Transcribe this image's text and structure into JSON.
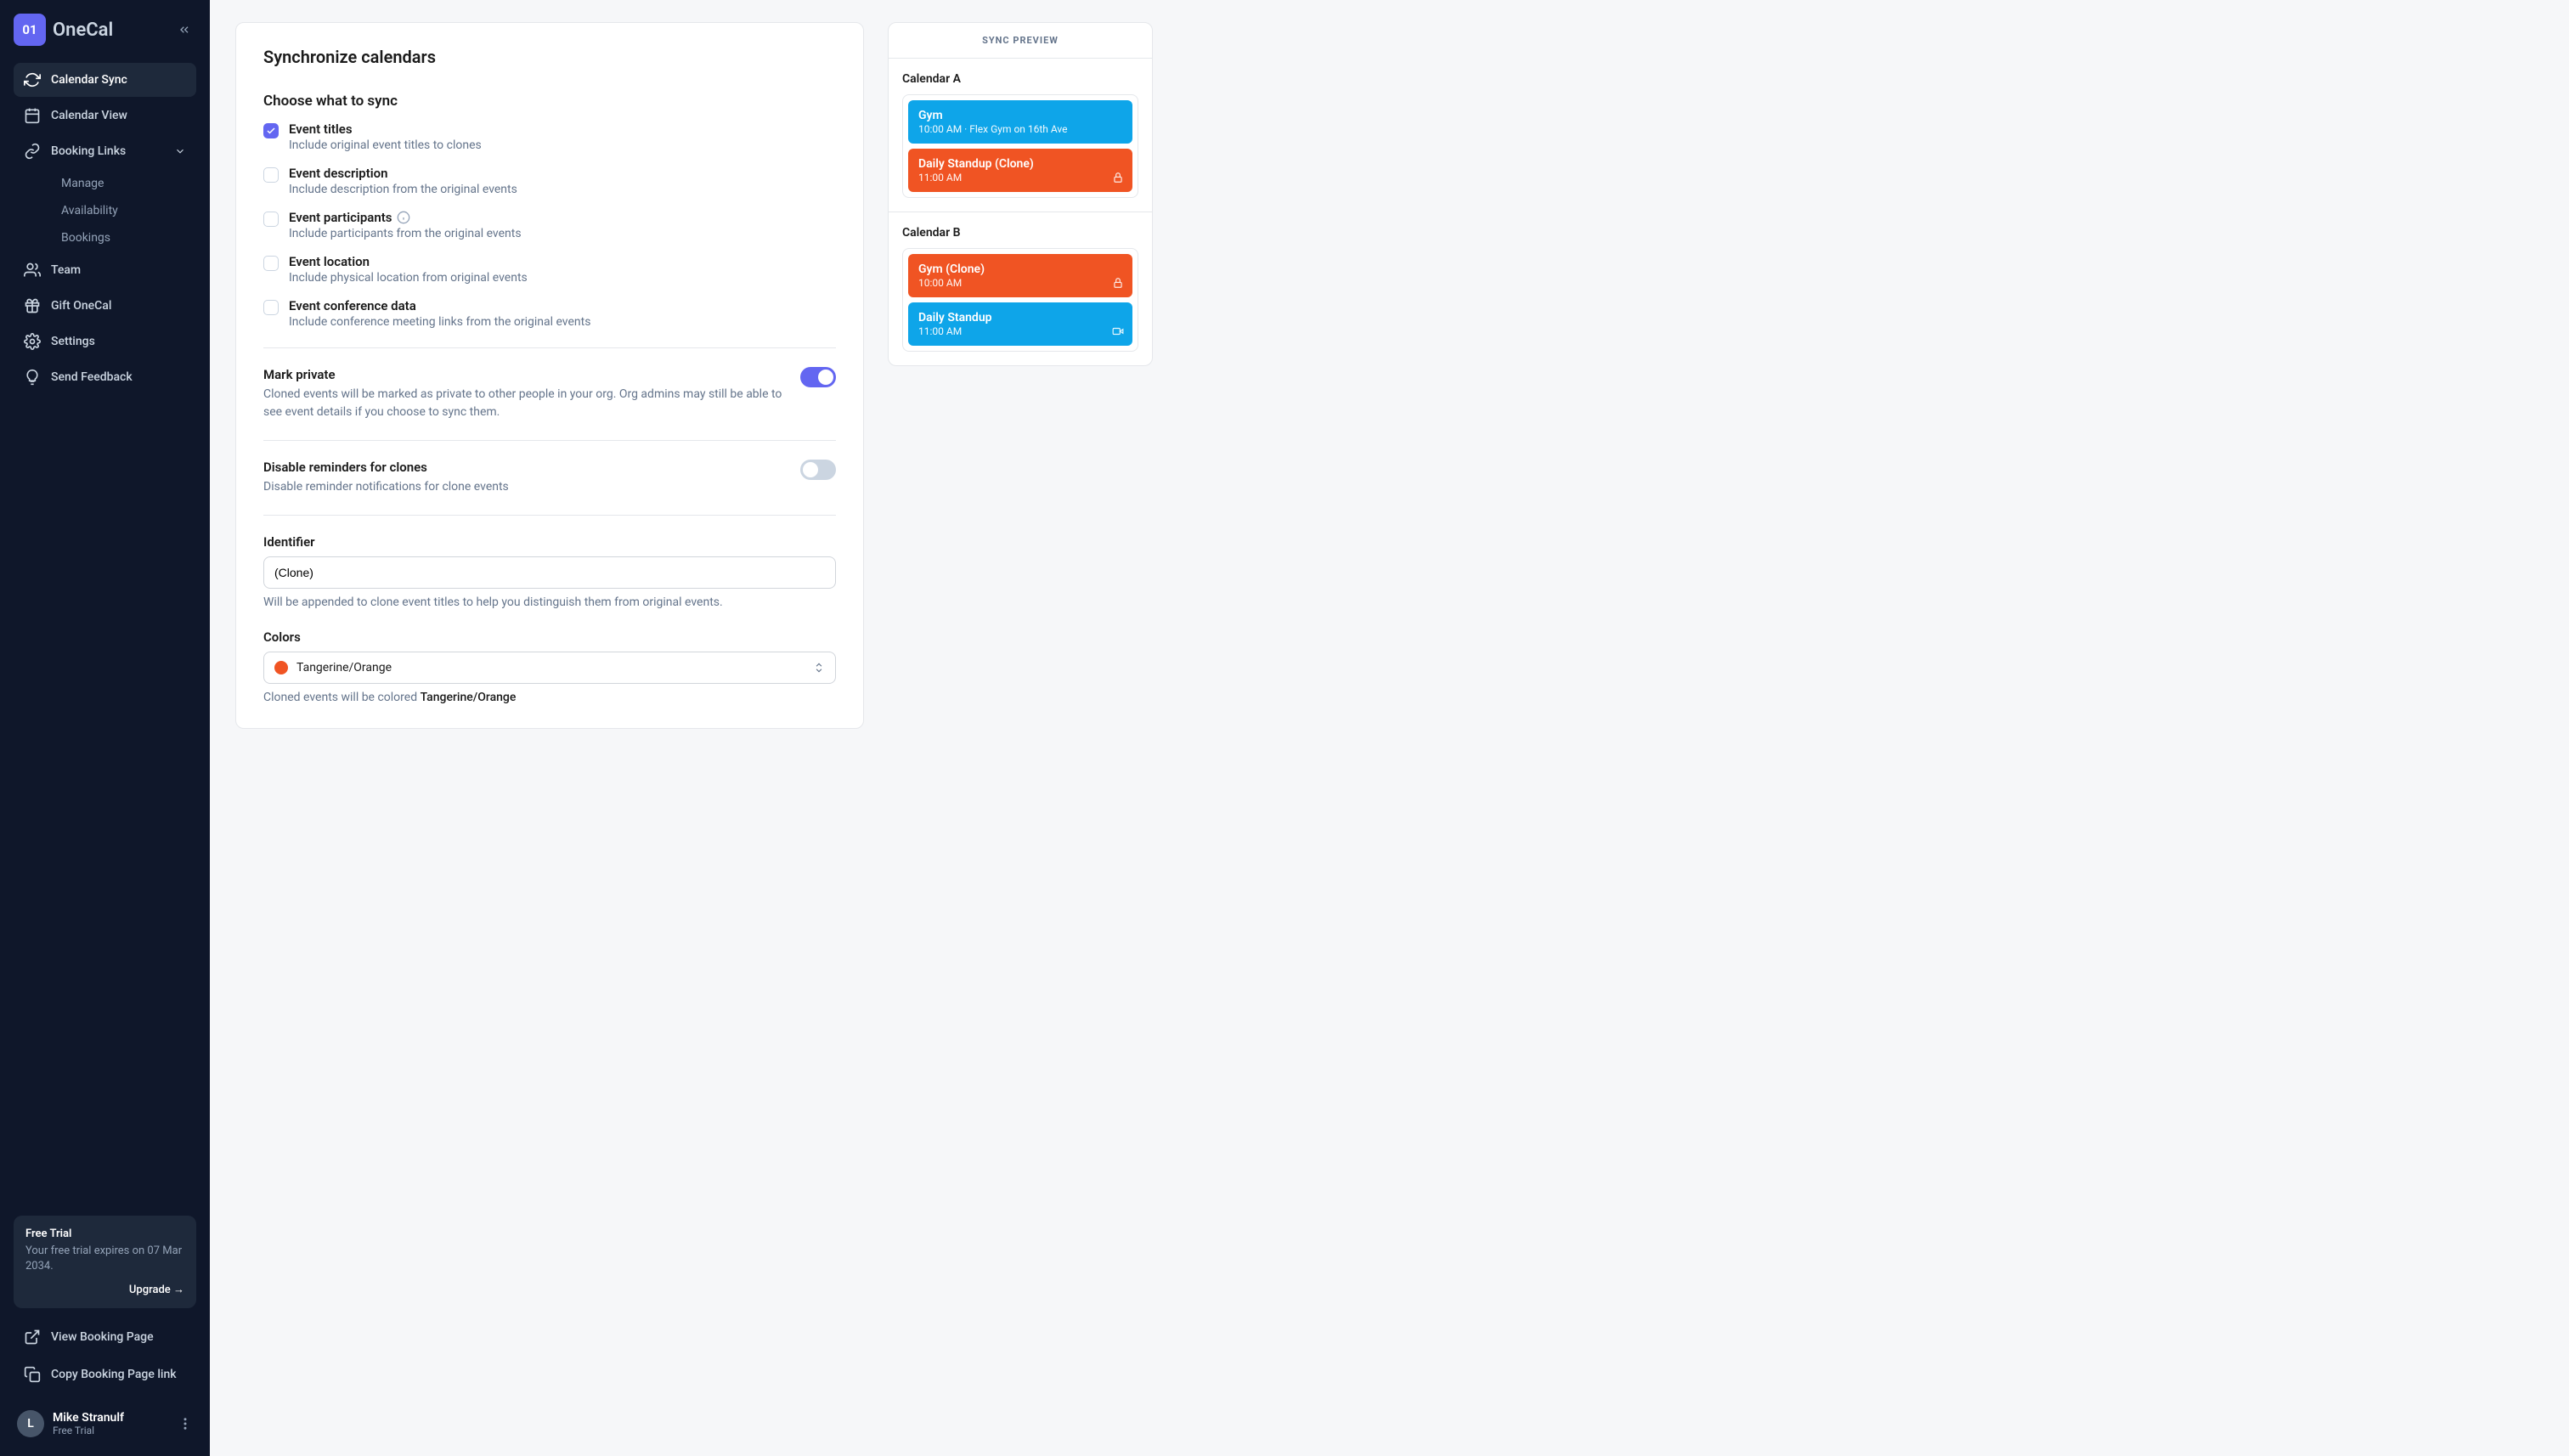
{
  "brand": {
    "badge": "01",
    "name": "OneCal"
  },
  "sidebar": {
    "items": [
      {
        "label": "Calendar Sync"
      },
      {
        "label": "Calendar View"
      },
      {
        "label": "Booking Links"
      },
      {
        "label": "Team"
      },
      {
        "label": "Gift OneCal"
      },
      {
        "label": "Settings"
      },
      {
        "label": "Send Feedback"
      }
    ],
    "booking_sub": [
      {
        "label": "Manage"
      },
      {
        "label": "Availability"
      },
      {
        "label": "Bookings"
      }
    ],
    "trial": {
      "title": "Free Trial",
      "desc": "Your free trial expires on 07 Mar 2034.",
      "upgrade": "Upgrade →"
    },
    "footer": [
      {
        "label": "View Booking Page"
      },
      {
        "label": "Copy Booking Page link"
      }
    ],
    "user": {
      "initial": "L",
      "name": "Mike Stranulf",
      "plan": "Free Trial"
    }
  },
  "page": {
    "title": "Synchronize calendars",
    "choose_title": "Choose what to sync",
    "options": [
      {
        "label": "Event titles",
        "desc": "Include original event titles to clones",
        "checked": true
      },
      {
        "label": "Event description",
        "desc": "Include description from the original events",
        "checked": false
      },
      {
        "label": "Event participants",
        "desc": "Include participants from the original events",
        "checked": false,
        "info": true
      },
      {
        "label": "Event location",
        "desc": "Include physical location from original events",
        "checked": false
      },
      {
        "label": "Event conference data",
        "desc": "Include conference meeting links from the original events",
        "checked": false
      }
    ],
    "mark_private": {
      "label": "Mark private",
      "desc": "Cloned events will be marked as private to other people in your org. Org admins may still be able to see event details if you choose to sync them.",
      "on": true
    },
    "disable_reminders": {
      "label": "Disable reminders for clones",
      "desc": "Disable reminder notifications for clone events",
      "on": false
    },
    "identifier": {
      "label": "Identifier",
      "value": "(Clone)",
      "help": "Will be appended to clone event titles to help you distinguish them from original events."
    },
    "colors": {
      "label": "Colors",
      "selected": "Tangerine/Orange",
      "swatch": "#f05423",
      "help_prefix": "Cloned events will be colored ",
      "help_value": "Tangerine/Orange"
    }
  },
  "preview": {
    "header": "SYNC PREVIEW",
    "calendars": [
      {
        "name": "Calendar A",
        "events": [
          {
            "title": "Gym",
            "time": "10:00 AM · Flex Gym on 16th Ave",
            "color": "blue",
            "badge": null
          },
          {
            "title": "Daily Standup (Clone)",
            "time": "11:00 AM",
            "color": "orange",
            "badge": "lock"
          }
        ]
      },
      {
        "name": "Calendar B",
        "events": [
          {
            "title": "Gym (Clone)",
            "time": "10:00 AM",
            "color": "orange",
            "badge": "lock"
          },
          {
            "title": "Daily Standup",
            "time": "11:00 AM",
            "color": "blue",
            "badge": "video"
          }
        ]
      }
    ]
  }
}
